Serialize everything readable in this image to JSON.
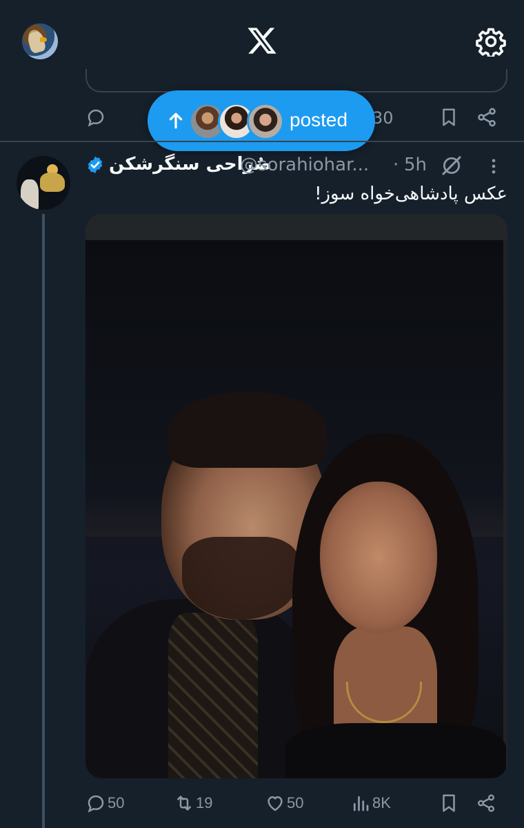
{
  "header": {
    "logo": "X",
    "profile_avatar_icon": "user-avatar-eagle",
    "settings_icon": "gear-icon"
  },
  "previous_tweet": {
    "views_fragment": "30"
  },
  "new_posts_pill": {
    "label": "posted",
    "arrow_icon": "arrow-up-icon",
    "avatar_count": 3
  },
  "tweet": {
    "display_name": "صُراحی سنگرشکن",
    "handle": "@sorahiohar...",
    "separator": "·",
    "time": "5h",
    "verified": true,
    "text": "عکس پادشاهی‌خواه سوز!",
    "media_description_icon": "photo",
    "stats": {
      "replies": "50",
      "retweets": "19",
      "likes": "50",
      "views": "8K"
    }
  },
  "colors": {
    "background": "#15202b",
    "accent": "#1d9bf0",
    "muted_text": "#8b98a5",
    "divider": "#38444d"
  }
}
